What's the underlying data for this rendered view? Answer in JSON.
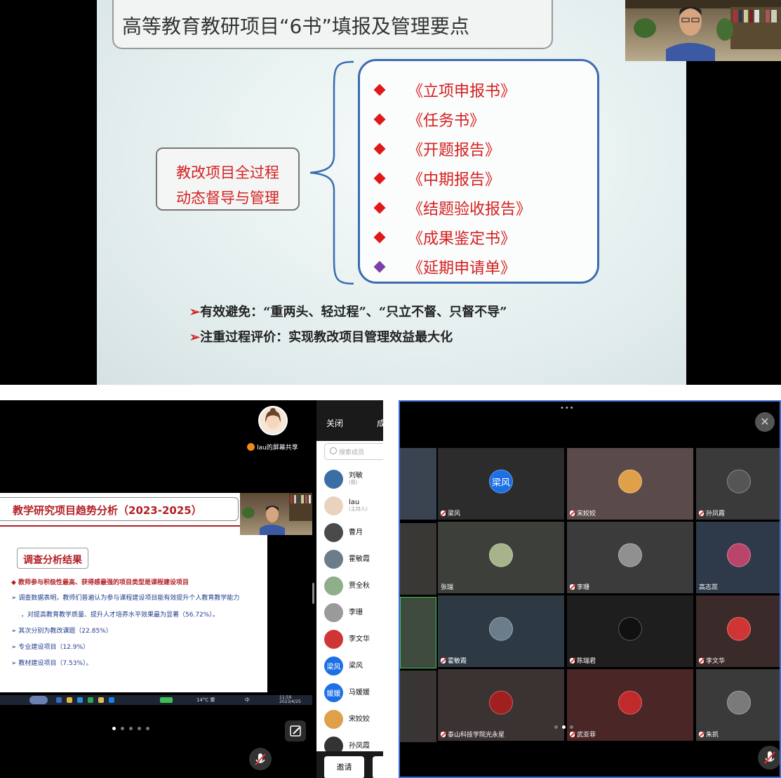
{
  "slide": {
    "title": "高等教育教研项目“6书”填报及管理要点",
    "left_box": [
      "教改项目全过程",
      "动态督导与管理"
    ],
    "items": [
      {
        "label": "《立项申报书》",
        "color": "#e01818"
      },
      {
        "label": "《任务书》",
        "color": "#e01818"
      },
      {
        "label": "《开题报告》",
        "color": "#e01818"
      },
      {
        "label": "《中期报告》",
        "color": "#e01818"
      },
      {
        "label": "《结题验收报告》",
        "color": "#e01818"
      },
      {
        "label": "《成果鉴定书》",
        "color": "#e01818"
      },
      {
        "label": "《延期申请单》",
        "color": "#7a3fa8"
      }
    ],
    "bullets": [
      "有效避免：“重两头、轻过程”、“只立不督、只督不导”",
      "注重过程评价：实现教改项目管理效益最大化"
    ]
  },
  "share": {
    "label": "lau的屏幕共享",
    "slide_title": "教学研究项目趋势分析（2023-2025）",
    "slide_subtitle": "调查分析结果",
    "lines": [
      "◆ 教师参与积极性最高、获得感最强的项目类型是课程建设项目",
      "➢ 调查数据表明，教师们普遍认为参与课程建设项目能有效提升个人教育教学能力",
      "，对提高教育教学质量、提升人才培养水平效果最为显著（56.72%）。",
      "➢ 其次分别为教改课题（22.85%）",
      "➢ 专业建设项目（12.9%）",
      "➢ 教材建设项目（7.53%）。"
    ],
    "taskbar_weather": "14°C 雾",
    "taskbar_lang": "中",
    "taskbar_time": "11:59",
    "taskbar_date": "2023/4/25"
  },
  "members": {
    "close_label": "关闭",
    "cheng_label": "成",
    "search_placeholder": "搜索成员",
    "list": [
      {
        "name": "刘敏",
        "role": "(我)",
        "avatar_color": "#3a6ea5",
        "avatar_text": ""
      },
      {
        "name": "lau",
        "role": "(主持人)",
        "avatar_color": "#e9d3bd",
        "avatar_text": ""
      },
      {
        "name": "曹月",
        "role": "",
        "avatar_color": "#4a4a4a",
        "avatar_text": ""
      },
      {
        "name": "霍敏霞",
        "role": "",
        "avatar_color": "#6b7d8a",
        "avatar_text": ""
      },
      {
        "name": "贾全秋",
        "role": "",
        "avatar_color": "#8fae8a",
        "avatar_text": ""
      },
      {
        "name": "李珊",
        "role": "",
        "avatar_color": "#9a9a9a",
        "avatar_text": ""
      },
      {
        "name": "李文华",
        "role": "",
        "avatar_color": "#d03535",
        "avatar_text": ""
      },
      {
        "name": "梁风",
        "role": "",
        "avatar_color": "#1d6fe6",
        "avatar_text": "梁风"
      },
      {
        "name": "马媛媛",
        "role": "",
        "avatar_color": "#1d6fe6",
        "avatar_text": "媛媛"
      },
      {
        "name": "宋姣姣",
        "role": "",
        "avatar_color": "#e0a04a",
        "avatar_text": ""
      },
      {
        "name": "孙凤霞",
        "role": "",
        "avatar_color": "#333333",
        "avatar_text": ""
      }
    ],
    "invite_label": "邀请"
  },
  "grid": {
    "close_symbol": "✕",
    "tiles": [
      {
        "name": "梁风",
        "muted": true,
        "bg": "#2c2c2c",
        "avatar_color": "#1d6fe6",
        "avatar_text": "梁风"
      },
      {
        "name": "宋姣姣",
        "muted": true,
        "bg": "#5a4a4a",
        "avatar_color": "#e0a04a",
        "avatar_text": ""
      },
      {
        "name": "孙凤霞",
        "muted": true,
        "bg": "#3a3a3a",
        "avatar_color": "#555555",
        "avatar_text": ""
      },
      {
        "name": "张瑞",
        "muted": false,
        "bg": "#3d3f3a",
        "avatar_color": "#a7b38a",
        "avatar_text": ""
      },
      {
        "name": "李珊",
        "muted": true,
        "bg": "#3b3b3b",
        "avatar_color": "#909090",
        "avatar_text": ""
      },
      {
        "name": "高志蕊",
        "muted": false,
        "bg": "#2e3a4a",
        "avatar_color": "#b9466a",
        "avatar_text": ""
      },
      {
        "name": "霍敏霞",
        "muted": true,
        "bg": "#2d3a44",
        "avatar_color": "#6b7d8a",
        "avatar_text": ""
      },
      {
        "name": "陈瑞君",
        "muted": true,
        "bg": "#1e1e1e",
        "avatar_color": "#111111",
        "avatar_text": ""
      },
      {
        "name": "李文华",
        "muted": true,
        "bg": "#3a2a2a",
        "avatar_color": "#d03535",
        "avatar_text": ""
      },
      {
        "name": "泰山科技学院光永星",
        "muted": true,
        "bg": "#3b3232",
        "avatar_color": "#a02020",
        "avatar_text": ""
      },
      {
        "name": "武亚菲",
        "muted": true,
        "bg": "#4a2626",
        "avatar_color": "#c02a2a",
        "avatar_text": ""
      },
      {
        "name": "朱凯",
        "muted": true,
        "bg": "#3a3a3a",
        "avatar_color": "#7a7a7a",
        "avatar_text": ""
      }
    ]
  }
}
